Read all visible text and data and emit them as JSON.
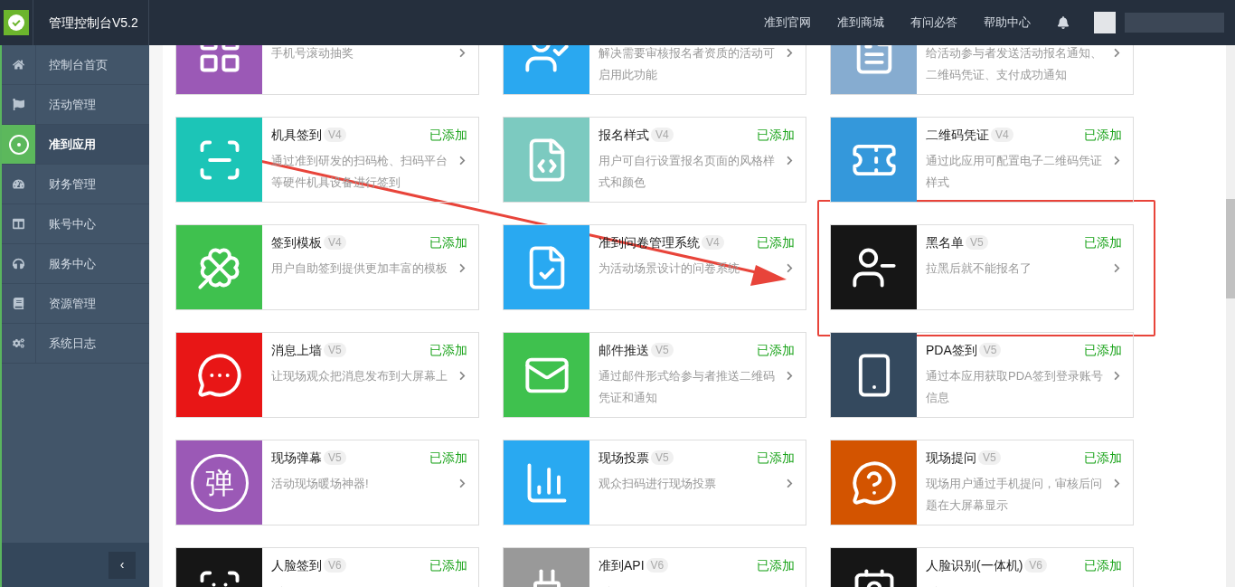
{
  "header": {
    "title": "管理控制台V5.2",
    "links": [
      "准到官网",
      "准到商城",
      "有问必答",
      "帮助中心"
    ]
  },
  "sidebar": {
    "items": [
      {
        "label": "控制台首页",
        "kind": "home",
        "selected": false
      },
      {
        "label": "活动管理",
        "kind": "flag",
        "selected": false
      },
      {
        "label": "准到应用",
        "kind": "apps",
        "selected": true
      },
      {
        "label": "财务管理",
        "kind": "gauge",
        "selected": false
      },
      {
        "label": "账号中心",
        "kind": "panel",
        "selected": false
      },
      {
        "label": "服务中心",
        "kind": "headset",
        "selected": false
      },
      {
        "label": "资源管理",
        "kind": "book",
        "selected": false
      },
      {
        "label": "系统日志",
        "kind": "cogs",
        "selected": false
      }
    ],
    "collapse": "‹"
  },
  "apps": [
    {
      "kind": "grid",
      "color": "#9b59b6",
      "description": "手机号滚动抽奖"
    },
    {
      "kind": "usercheck",
      "color": "#2aa8f0",
      "description": "解决需要审核报名者资质的活动可启用此功能"
    },
    {
      "kind": "notice",
      "color": "#86acd0",
      "description": "给活动参与者发送活动报名通知、二维码凭证、支付成功通知"
    },
    {
      "kind": "scanner",
      "color": "#1cc5b7",
      "title": "机具签到",
      "version": "V4",
      "status": "已添加",
      "description": "通过准到研发的扫码枪、扫码平台等硬件机具设备进行签到"
    },
    {
      "kind": "css",
      "color": "#7ccac0",
      "title": "报名样式",
      "version": "V4",
      "status": "已添加",
      "description": "用户可自行设置报名页面的风格样式和颜色"
    },
    {
      "kind": "ticket",
      "color": "#3498db",
      "title": "二维码凭证",
      "version": "V4",
      "status": "已添加",
      "description": "通过此应用可配置电子二维码凭证样式"
    },
    {
      "kind": "clover",
      "color": "#3fc14e",
      "title": "签到模板",
      "version": "V4",
      "status": "已添加",
      "description": "用户自助签到提供更加丰富的模板"
    },
    {
      "kind": "filecheck",
      "color": "#29a9f1",
      "title": "准到问卷管理系统",
      "version": "V4",
      "status": "已添加",
      "description": "为活动场景设计的问卷系统"
    },
    {
      "kind": "userminus",
      "color": "#161616",
      "title": "黑名单",
      "version": "V5",
      "status": "已添加",
      "description": "拉黑后就不能报名了"
    },
    {
      "kind": "chat",
      "color": "#e81616",
      "title": "消息上墙",
      "version": "V5",
      "status": "已添加",
      "description": "让现场观众把消息发布到大屏幕上"
    },
    {
      "kind": "mail",
      "color": "#3fc14e",
      "title": "邮件推送",
      "version": "V5",
      "status": "已添加",
      "description": "通过邮件形式给参与者推送二维码凭证和通知"
    },
    {
      "kind": "phone",
      "color": "#34495e",
      "title": "PDA签到",
      "version": "V5",
      "status": "已添加",
      "description": "通过本应用获取PDA签到登录账号信息"
    },
    {
      "kind": "glyph",
      "glyph": "弹",
      "color": "#9b59b6",
      "title": "现场弹幕",
      "version": "V5",
      "status": "已添加",
      "description": "活动现场暖场神器!"
    },
    {
      "kind": "chart",
      "color": "#29a9f1",
      "title": "现场投票",
      "version": "V5",
      "status": "已添加",
      "description": "观众扫码进行现场投票"
    },
    {
      "kind": "question",
      "color": "#d35400",
      "title": "现场提问",
      "version": "V5",
      "status": "已添加",
      "description": "现场用户通过手机提问，审核后问题在大屏幕显示"
    },
    {
      "kind": "face",
      "color": "#161616",
      "title": "人脸签到",
      "version": "V6",
      "status": "已添加"
    },
    {
      "kind": "plug",
      "color": "#999999",
      "title": "准到API",
      "version": "V6",
      "status": "已添加"
    },
    {
      "kind": "idcard",
      "color": "#161616",
      "title": "人脸识别(一体机)",
      "version": "V6",
      "status": "已添加"
    }
  ]
}
